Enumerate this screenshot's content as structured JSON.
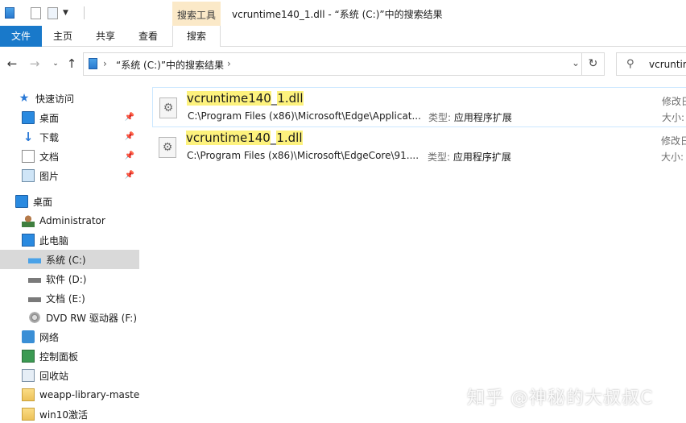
{
  "titlebar": {
    "context_tool_label": "搜索工具",
    "window_title": "vcruntime140_1.dll - “系统 (C:)”中的搜索结果"
  },
  "ribbon": {
    "tabs": [
      {
        "label": "文件",
        "active": false
      },
      {
        "label": "主页",
        "active": false
      },
      {
        "label": "共享",
        "active": false
      },
      {
        "label": "查看",
        "active": false
      },
      {
        "label": "搜索",
        "active": true
      }
    ]
  },
  "address": {
    "crumb": "“系统 (C:)”中的搜索结果",
    "search_value": "vcruntim"
  },
  "nav": {
    "quick_access": "快速访问",
    "pinned": [
      {
        "label": "桌面",
        "icon": "desktop-icon"
      },
      {
        "label": "下载",
        "icon": "download-icon"
      },
      {
        "label": "文档",
        "icon": "document-icon"
      },
      {
        "label": "图片",
        "icon": "picture-icon"
      }
    ],
    "desktop": "桌面",
    "user": "Administrator",
    "this_pc": "此电脑",
    "drives": [
      {
        "label": "系统 (C:)",
        "selected": true
      },
      {
        "label": "软件 (D:)",
        "selected": false
      },
      {
        "label": "文档 (E:)",
        "selected": false
      },
      {
        "label": "DVD RW 驱动器 (F:)",
        "selected": false
      }
    ],
    "network": "网络",
    "control_panel": "控制面板",
    "recycle_bin": "回收站",
    "folders": [
      "weapp-library-master",
      "win10激活"
    ]
  },
  "results": [
    {
      "name_pre": "vcruntime140",
      "name_sep": "_",
      "name_post": "1.dll",
      "path": "C:\\Program Files (x86)\\Microsoft\\Edge\\Applicat...",
      "type_label": "类型:",
      "type_value": "应用程序扩展",
      "meta1": "修改日",
      "meta2": "大小:"
    },
    {
      "name_pre": "vcruntime140",
      "name_sep": "_",
      "name_post": "1.dll",
      "path": "C:\\Program Files (x86)\\Microsoft\\EdgeCore\\91....",
      "type_label": "类型:",
      "type_value": "应用程序扩展",
      "meta1": "修改日",
      "meta2": "大小:"
    }
  ],
  "watermark": "知乎 @神秘的大叔叔C",
  "colors": {
    "file_tab": "#1979ca",
    "context_tab": "#fbe9c8",
    "highlight": "#fdf27d",
    "selected_nav": "#d9d9d9"
  }
}
